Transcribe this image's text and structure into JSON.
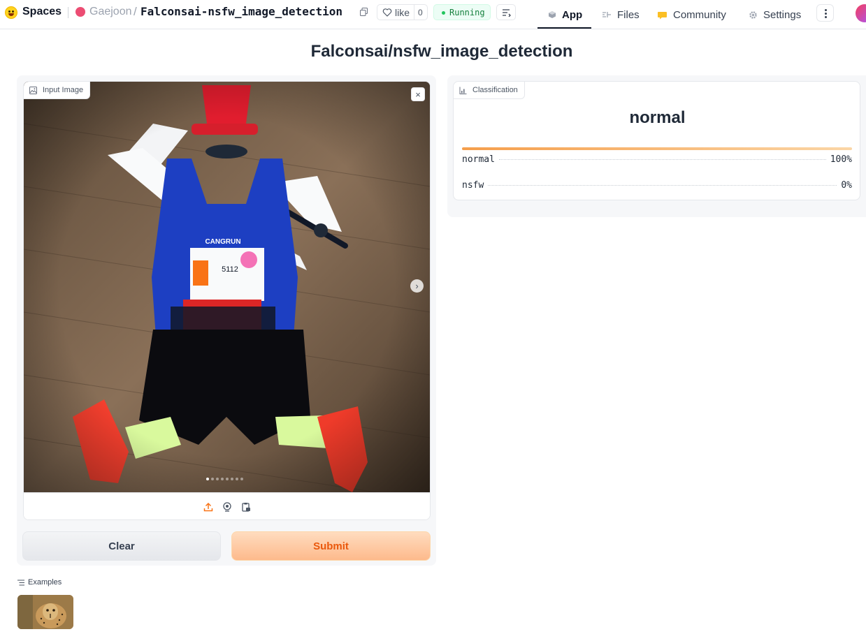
{
  "header": {
    "brand": "Spaces",
    "owner": "Gaejoon",
    "separator": "/",
    "repo_name": "Falconsai-nsfw_image_detection",
    "like_label": "like",
    "like_count": "0",
    "status": "Running",
    "tabs": [
      {
        "label": "App",
        "icon": "app-cube-icon",
        "active": true
      },
      {
        "label": "Files",
        "icon": "files-icon",
        "active": false
      },
      {
        "label": "Community",
        "icon": "community-icon",
        "active": false
      },
      {
        "label": "Settings",
        "icon": "gear-icon",
        "active": false
      }
    ]
  },
  "title": "Falconsai/nsfw_image_detection",
  "input": {
    "label": "Input Image",
    "close_glyph": "×",
    "next_glyph": "›",
    "carousel": {
      "count": 8,
      "current": 1
    },
    "sources": [
      "upload-icon",
      "webcam-icon",
      "clipboard-icon"
    ]
  },
  "buttons": {
    "clear": "Clear",
    "submit": "Submit"
  },
  "output": {
    "label": "Classification",
    "top_label": "normal",
    "top_confidence": 1.0,
    "confidences": [
      {
        "label": "normal",
        "value": "100%"
      },
      {
        "label": "nsfw",
        "value": "0%"
      }
    ]
  },
  "examples": {
    "label": "Examples",
    "items": [
      "cheetah-example-thumbnail"
    ]
  },
  "colors": {
    "accent_orange": "#f97316",
    "running_green": "#22c55e",
    "submit_text": "#ea580c"
  }
}
